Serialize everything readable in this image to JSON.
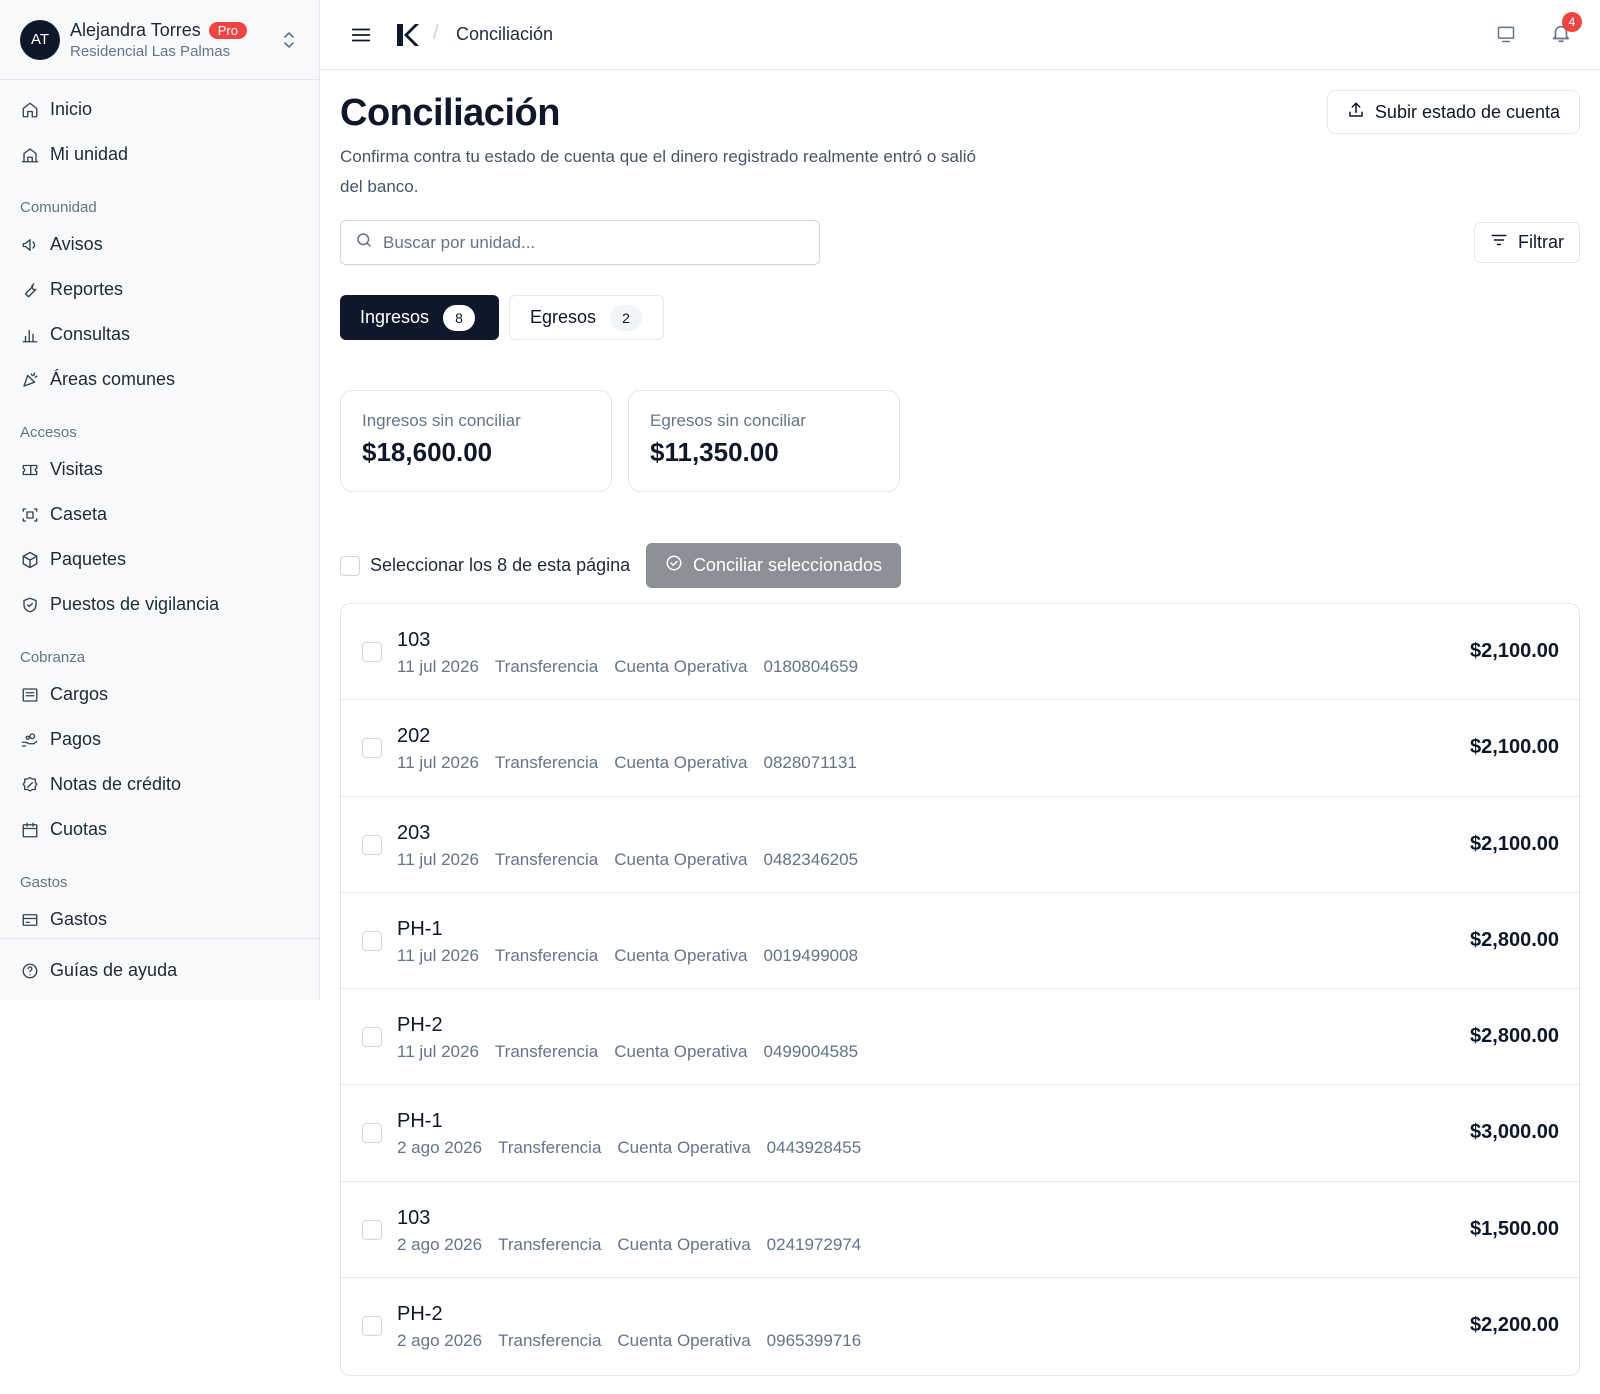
{
  "user": {
    "initials": "AT",
    "name": "Alejandra Torres",
    "badge": "Pro",
    "community": "Residencial Las Palmas"
  },
  "nav": {
    "top": [
      {
        "label": "Inicio",
        "icon": "home-icon"
      },
      {
        "label": "Mi unidad",
        "icon": "house-icon"
      }
    ],
    "sections": [
      {
        "title": "Comunidad",
        "items": [
          {
            "label": "Avisos",
            "icon": "megaphone-icon"
          },
          {
            "label": "Reportes",
            "icon": "wrench-icon"
          },
          {
            "label": "Consultas",
            "icon": "bar-chart-icon"
          },
          {
            "label": "Áreas comunes",
            "icon": "party-popper-icon"
          }
        ]
      },
      {
        "title": "Accesos",
        "items": [
          {
            "label": "Visitas",
            "icon": "ticket-icon"
          },
          {
            "label": "Caseta",
            "icon": "scan-icon"
          },
          {
            "label": "Paquetes",
            "icon": "package-icon"
          },
          {
            "label": "Puestos de vigilancia",
            "icon": "shield-icon"
          }
        ]
      },
      {
        "title": "Cobranza",
        "items": [
          {
            "label": "Cargos",
            "icon": "receipt-icon"
          },
          {
            "label": "Pagos",
            "icon": "hand-coins-icon"
          },
          {
            "label": "Notas de crédito",
            "icon": "badge-percent-icon"
          },
          {
            "label": "Cuotas",
            "icon": "calendar-icon"
          }
        ]
      },
      {
        "title": "Gastos",
        "items": [
          {
            "label": "Gastos",
            "icon": "wallet-icon"
          }
        ]
      }
    ],
    "bottom": {
      "label": "Guías de ayuda",
      "icon": "help-circle-icon"
    }
  },
  "topbar": {
    "breadcrumb": "Conciliación",
    "notifications": "4"
  },
  "page": {
    "title": "Conciliación",
    "description": "Confirma contra tu estado de cuenta que el dinero registrado realmente entró o salió del banco.",
    "upload_label": "Subir estado de cuenta",
    "search_placeholder": "Buscar por unidad...",
    "filter_label": "Filtrar",
    "tabs": [
      {
        "label": "Ingresos",
        "count": "8",
        "active": true
      },
      {
        "label": "Egresos",
        "count": "2",
        "active": false
      }
    ],
    "stats": [
      {
        "label": "Ingresos sin conciliar",
        "value": "$18,600.00"
      },
      {
        "label": "Egresos sin conciliar",
        "value": "$11,350.00"
      }
    ],
    "select_all_label": "Seleccionar los 8 de esta página",
    "reconcile_label": "Conciliar seleccionados"
  },
  "rows": [
    {
      "unit": "103",
      "date": "11 jul 2026",
      "method": "Transferencia",
      "account": "Cuenta Operativa",
      "ref": "0180804659",
      "amount": "$2,100.00"
    },
    {
      "unit": "202",
      "date": "11 jul 2026",
      "method": "Transferencia",
      "account": "Cuenta Operativa",
      "ref": "0828071131",
      "amount": "$2,100.00"
    },
    {
      "unit": "203",
      "date": "11 jul 2026",
      "method": "Transferencia",
      "account": "Cuenta Operativa",
      "ref": "0482346205",
      "amount": "$2,100.00"
    },
    {
      "unit": "PH-1",
      "date": "11 jul 2026",
      "method": "Transferencia",
      "account": "Cuenta Operativa",
      "ref": "0019499008",
      "amount": "$2,800.00"
    },
    {
      "unit": "PH-2",
      "date": "11 jul 2026",
      "method": "Transferencia",
      "account": "Cuenta Operativa",
      "ref": "0499004585",
      "amount": "$2,800.00"
    },
    {
      "unit": "PH-1",
      "date": "2 ago 2026",
      "method": "Transferencia",
      "account": "Cuenta Operativa",
      "ref": "0443928455",
      "amount": "$3,000.00"
    },
    {
      "unit": "103",
      "date": "2 ago 2026",
      "method": "Transferencia",
      "account": "Cuenta Operativa",
      "ref": "0241972974",
      "amount": "$1,500.00"
    },
    {
      "unit": "PH-2",
      "date": "2 ago 2026",
      "method": "Transferencia",
      "account": "Cuenta Operativa",
      "ref": "0965399716",
      "amount": "$2,200.00"
    }
  ]
}
